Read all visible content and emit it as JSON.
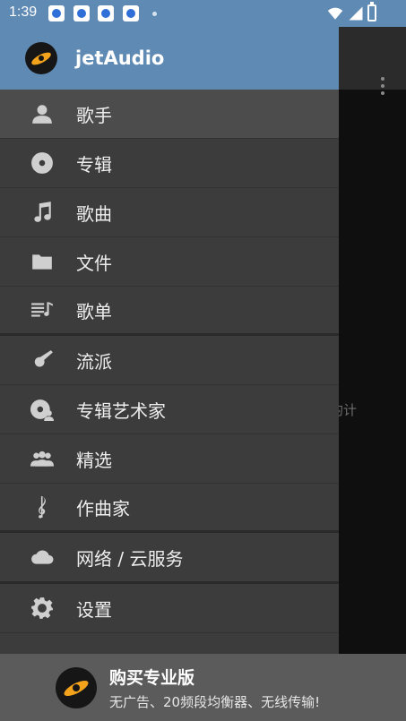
{
  "status_bar": {
    "time": "1:39",
    "notification_icons": [
      "tieba-icon",
      "baidu-paw-icon",
      "baidu-paw-icon",
      "baidu-paw-icon"
    ],
    "system_icons": [
      "wifi-icon",
      "signal-icon",
      "battery-charging-icon"
    ]
  },
  "drawer": {
    "title": "jetAudio",
    "items": [
      {
        "label": "歌手",
        "icon": "artist-icon",
        "active": true
      },
      {
        "label": "专辑",
        "icon": "album-disc-icon"
      },
      {
        "label": "歌曲",
        "icon": "music-note-icon"
      },
      {
        "label": "文件",
        "icon": "folder-icon"
      },
      {
        "label": "歌单",
        "icon": "playlist-icon"
      },
      {
        "label": "流派",
        "icon": "guitar-icon"
      },
      {
        "label": "专辑艺术家",
        "icon": "album-artist-icon"
      },
      {
        "label": "精选",
        "icon": "group-icon"
      },
      {
        "label": "作曲家",
        "icon": "treble-clef-icon"
      },
      {
        "label": "网络 / 云服务",
        "icon": "cloud-icon"
      },
      {
        "label": "设置",
        "icon": "settings-gear-icon"
      }
    ]
  },
  "background": {
    "partial_text": "的计"
  },
  "promo": {
    "title": "购买专业版",
    "subtitle": "无广告、20频段均衡器、无线传输!"
  },
  "colors": {
    "header": "#5f8ab4",
    "drawer": "#3c3c3c",
    "active_item": "#4c4c4c",
    "promo": "#5b5b5b",
    "logo_accent": "#f2a21b"
  }
}
